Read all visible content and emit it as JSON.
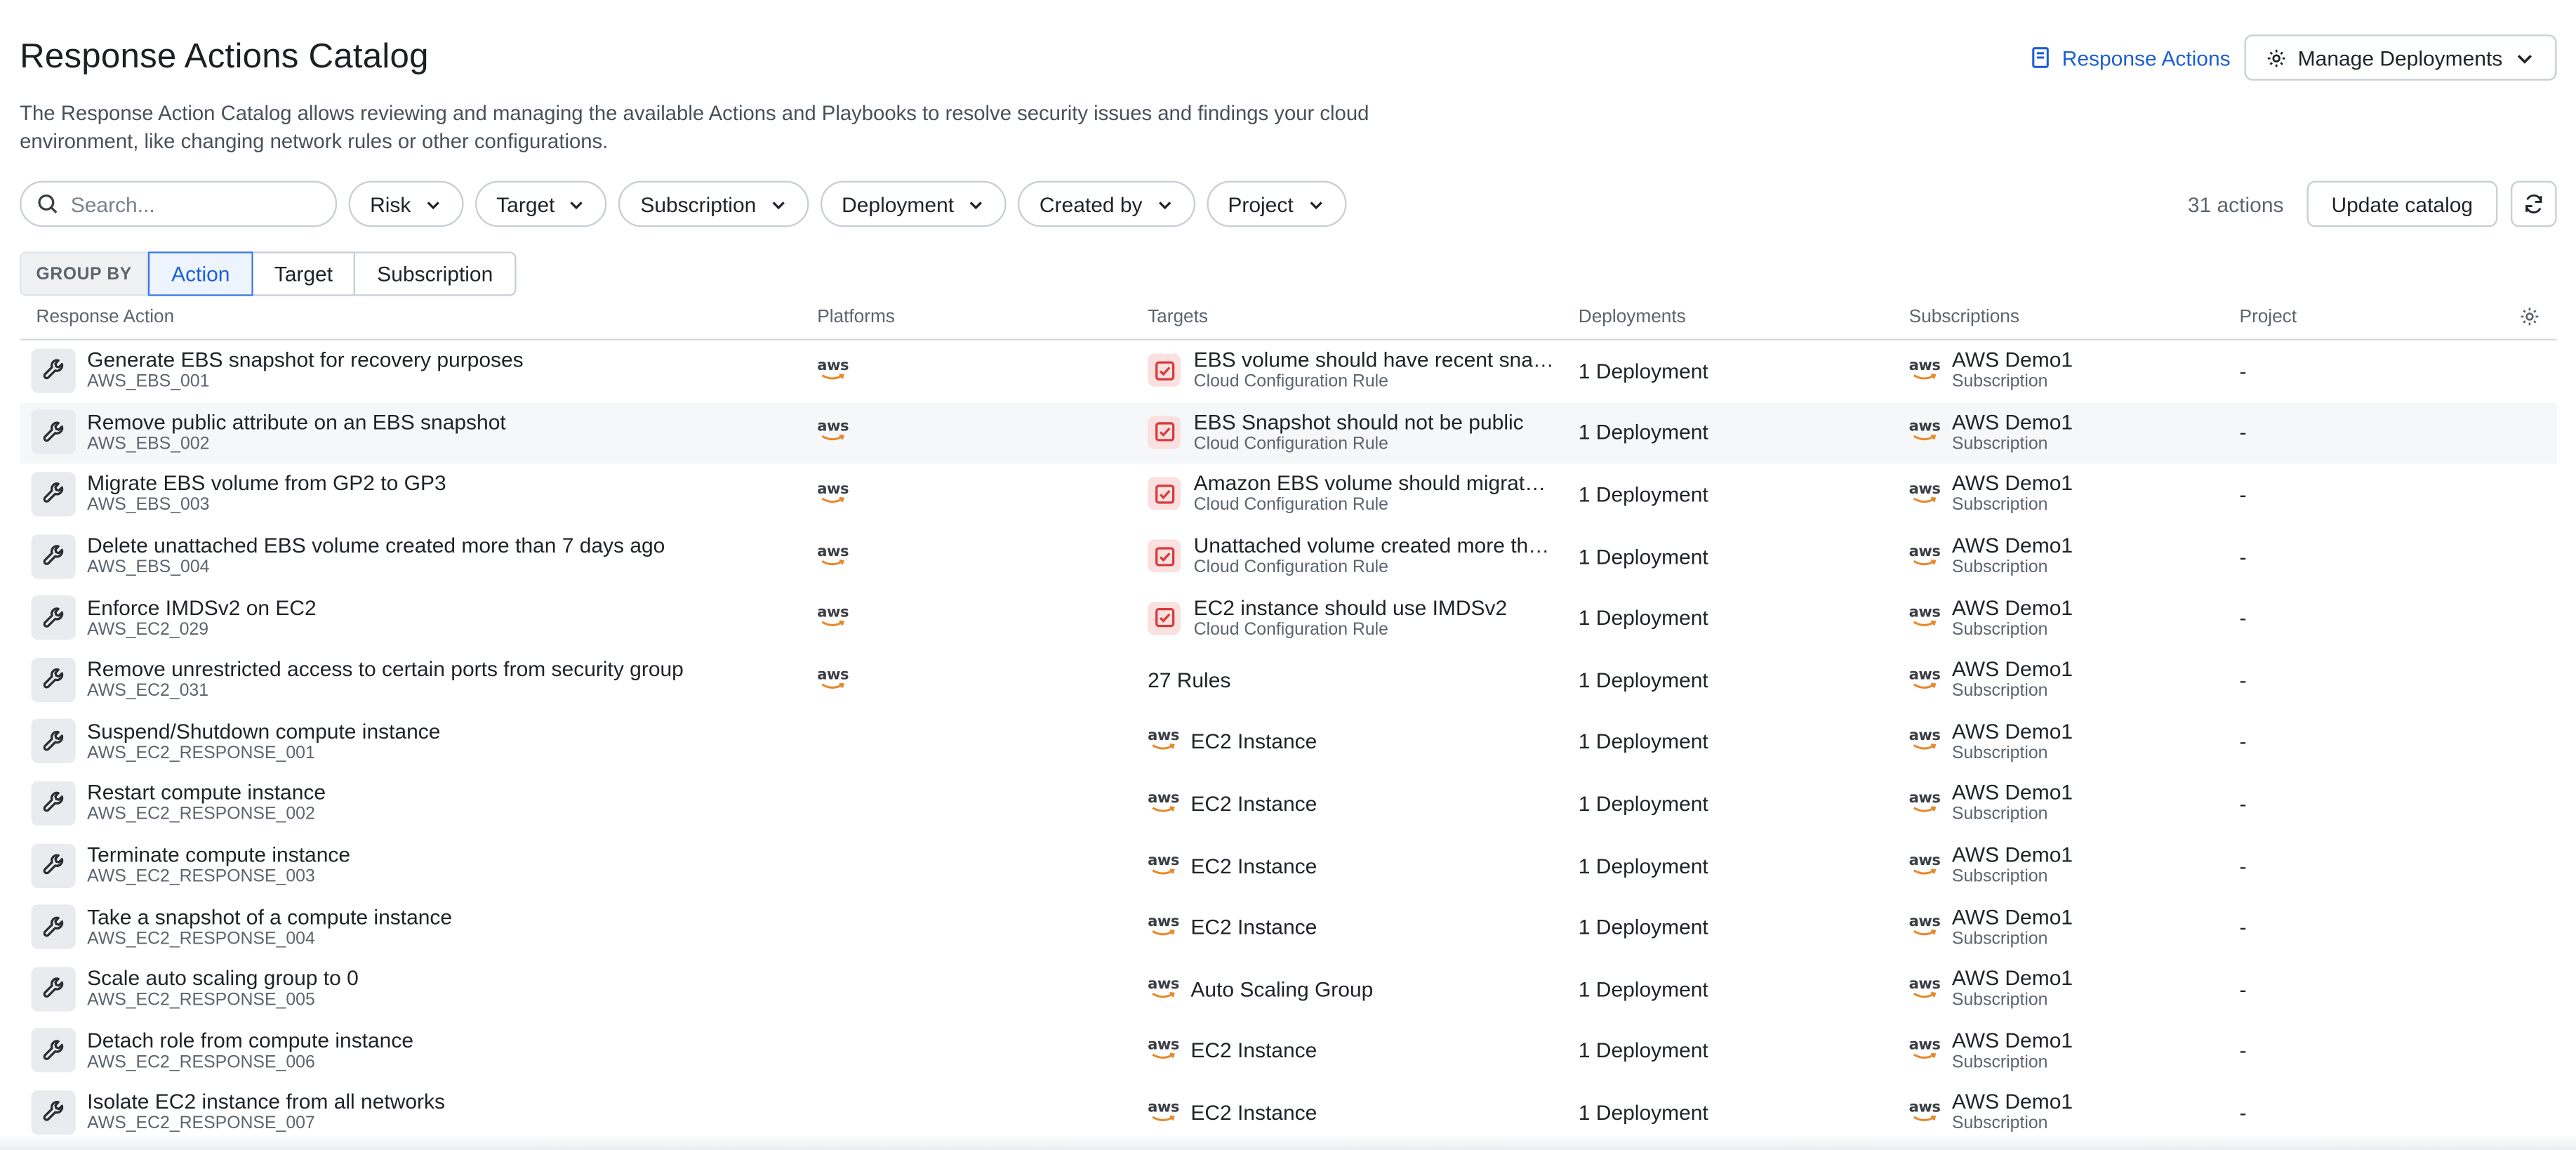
{
  "header": {
    "title": "Response Actions Catalog",
    "description": "The Response Action Catalog allows reviewing and managing the available Actions and Playbooks to resolve security issues and findings your cloud environment, like changing network rules or other configurations.",
    "response_actions_link": "Response Actions",
    "manage_deployments_label": "Manage Deployments"
  },
  "filters": {
    "search_placeholder": "Search...",
    "pills": [
      "Risk",
      "Target",
      "Subscription",
      "Deployment",
      "Created by",
      "Project"
    ],
    "count": "31 actions",
    "update_label": "Update catalog"
  },
  "groupby": {
    "label": "GROUP BY",
    "options": [
      "Action",
      "Target",
      "Subscription"
    ],
    "selected": "Action"
  },
  "table": {
    "columns": [
      "Response Action",
      "Platforms",
      "Targets",
      "Deployments",
      "Subscriptions",
      "Project"
    ],
    "rows": [
      {
        "name": "Generate EBS snapshot for recovery purposes",
        "id": "AWS_EBS_001",
        "platform": "aws",
        "target_type": "rule",
        "target": "EBS volume should have recent snaps...",
        "target_sub": "Cloud Configuration Rule",
        "deployments": "1 Deployment",
        "subscription": "AWS Demo1",
        "subscription_sub": "Subscription",
        "project": "-"
      },
      {
        "name": "Remove public attribute on an EBS snapshot",
        "id": "AWS_EBS_002",
        "platform": "aws",
        "target_type": "rule",
        "target": "EBS Snapshot should not be public",
        "target_sub": "Cloud Configuration Rule",
        "deployments": "1 Deployment",
        "subscription": "AWS Demo1",
        "subscription_sub": "Subscription",
        "project": "-"
      },
      {
        "name": "Migrate EBS volume from GP2 to GP3",
        "id": "AWS_EBS_003",
        "platform": "aws",
        "target_type": "rule",
        "target": "Amazon EBS volume should migrate fr...",
        "target_sub": "Cloud Configuration Rule",
        "deployments": "1 Deployment",
        "subscription": "AWS Demo1",
        "subscription_sub": "Subscription",
        "project": "-"
      },
      {
        "name": "Delete unattached EBS volume created more than 7 days ago",
        "id": "AWS_EBS_004",
        "platform": "aws",
        "target_type": "rule",
        "target": "Unattached volume created more tha...",
        "target_sub": "Cloud Configuration Rule",
        "deployments": "1 Deployment",
        "subscription": "AWS Demo1",
        "subscription_sub": "Subscription",
        "project": "-"
      },
      {
        "name": "Enforce IMDSv2 on EC2",
        "id": "AWS_EC2_029",
        "platform": "aws",
        "target_type": "rule",
        "target": "EC2 instance should use IMDSv2",
        "target_sub": "Cloud Configuration Rule",
        "deployments": "1 Deployment",
        "subscription": "AWS Demo1",
        "subscription_sub": "Subscription",
        "project": "-"
      },
      {
        "name": "Remove unrestricted access to certain ports from security group",
        "id": "AWS_EC2_031",
        "platform": "aws",
        "target_type": "text",
        "target": "27 Rules",
        "target_sub": "",
        "deployments": "1 Deployment",
        "subscription": "AWS Demo1",
        "subscription_sub": "Subscription",
        "project": "-"
      },
      {
        "name": "Suspend/Shutdown compute instance",
        "id": "AWS_EC2_RESPONSE_001",
        "platform": "",
        "target_type": "aws",
        "target": "EC2 Instance",
        "target_sub": "",
        "deployments": "1 Deployment",
        "subscription": "AWS Demo1",
        "subscription_sub": "Subscription",
        "project": "-"
      },
      {
        "name": "Restart compute instance",
        "id": "AWS_EC2_RESPONSE_002",
        "platform": "",
        "target_type": "aws",
        "target": "EC2 Instance",
        "target_sub": "",
        "deployments": "1 Deployment",
        "subscription": "AWS Demo1",
        "subscription_sub": "Subscription",
        "project": "-"
      },
      {
        "name": "Terminate compute instance",
        "id": "AWS_EC2_RESPONSE_003",
        "platform": "",
        "target_type": "aws",
        "target": "EC2 Instance",
        "target_sub": "",
        "deployments": "1 Deployment",
        "subscription": "AWS Demo1",
        "subscription_sub": "Subscription",
        "project": "-"
      },
      {
        "name": "Take a snapshot of a compute instance",
        "id": "AWS_EC2_RESPONSE_004",
        "platform": "",
        "target_type": "aws",
        "target": "EC2 Instance",
        "target_sub": "",
        "deployments": "1 Deployment",
        "subscription": "AWS Demo1",
        "subscription_sub": "Subscription",
        "project": "-"
      },
      {
        "name": "Scale auto scaling group to 0",
        "id": "AWS_EC2_RESPONSE_005",
        "platform": "",
        "target_type": "aws",
        "target": "Auto Scaling Group",
        "target_sub": "",
        "deployments": "1 Deployment",
        "subscription": "AWS Demo1",
        "subscription_sub": "Subscription",
        "project": "-"
      },
      {
        "name": "Detach role from compute instance",
        "id": "AWS_EC2_RESPONSE_006",
        "platform": "",
        "target_type": "aws",
        "target": "EC2 Instance",
        "target_sub": "",
        "deployments": "1 Deployment",
        "subscription": "AWS Demo1",
        "subscription_sub": "Subscription",
        "project": "-"
      },
      {
        "name": "Isolate EC2 instance from all networks",
        "id": "AWS_EC2_RESPONSE_007",
        "platform": "",
        "target_type": "aws",
        "target": "EC2 Instance",
        "target_sub": "",
        "deployments": "1 Deployment",
        "subscription": "AWS Demo1",
        "subscription_sub": "Subscription",
        "project": "-"
      }
    ]
  },
  "colors": {
    "accent": "#1c5fd4",
    "rule_icon_bg": "#fbe0e0",
    "rule_icon": "#d63b3b",
    "alt_row": "#f6f7f8"
  },
  "icons": {
    "action": "wrench-icon",
    "rule": "checkbox-icon",
    "link": "book-icon",
    "manage": "gear-icon",
    "search": "search-icon",
    "refresh": "refresh-icon",
    "column_settings": "gear-icon"
  }
}
